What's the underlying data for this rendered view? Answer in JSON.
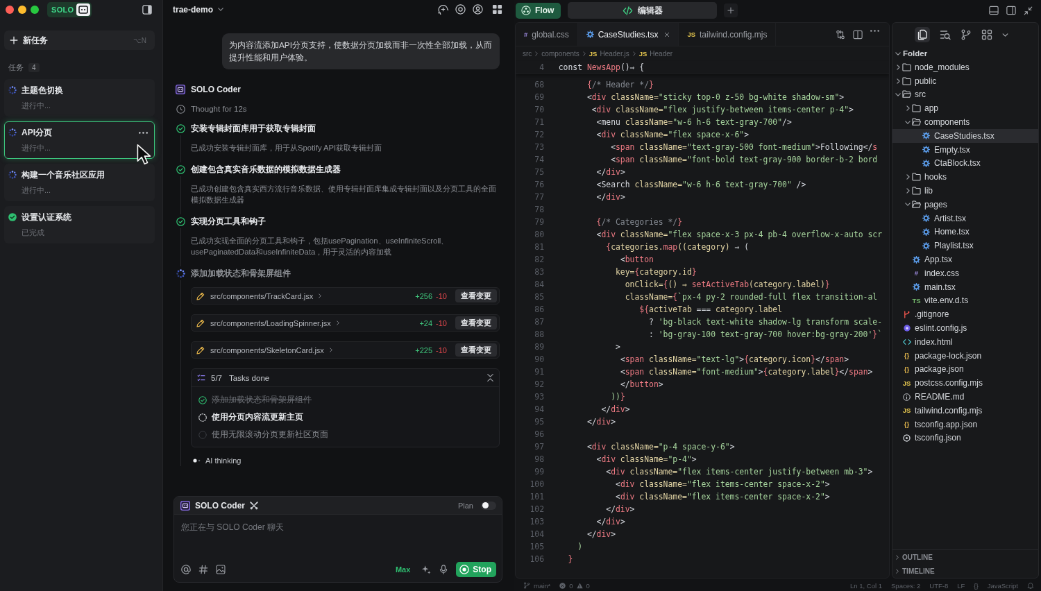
{
  "sidebar": {
    "badge": "SOLO",
    "new_task": {
      "label": "新任务",
      "shortcut": "⌥N"
    },
    "tasks_label": "任务",
    "tasks_count": "4",
    "tasks": [
      {
        "title": "主题色切换",
        "status_text": "进行中...",
        "kind": "running",
        "selected": false
      },
      {
        "title": "API分页",
        "status_text": "进行中...",
        "kind": "running",
        "selected": true
      },
      {
        "title": "构建一个音乐社区应用",
        "status_text": "进行中...",
        "kind": "running",
        "selected": false
      },
      {
        "title": "设置认证系统",
        "status_text": "已完成",
        "kind": "done",
        "selected": false
      }
    ]
  },
  "chat": {
    "project": "trae-demo",
    "user_message": "为内容流添加API分页支持，使数据分页加载而非一次性全部加载，从而提升性能和用户体验。",
    "agent": "SOLO Coder",
    "thought": "Thought for 12s",
    "steps": [
      {
        "title": "安装专辑封面库用于获取专辑封面",
        "detail": "已成功安装专辑封面库，用于从Spotify API获取专辑封面",
        "kind": "done"
      },
      {
        "title": "创建包含真实音乐数据的模拟数据生成器",
        "detail": "已成功创建包含真实西方流行音乐数据、使用专辑封面库集成专辑封面以及分页工具的全面模拟数据生成器",
        "kind": "done"
      },
      {
        "title": "实现分页工具和钩子",
        "detail": "已成功实现全面的分页工具和钩子，包括usePagination、useInfiniteScroll、usePaginatedData和useInfiniteData，用于灵活的内容加载",
        "kind": "done"
      },
      {
        "title": "添加加载状态和骨架屏组件",
        "kind": "running"
      }
    ],
    "changes": [
      {
        "path": "src/components/TrackCard.jsx",
        "added": "+256",
        "removed": "-10",
        "action": "查看变更"
      },
      {
        "path": "src/components/LoadingSpinner.jsx",
        "added": "+24",
        "removed": "-10",
        "action": "查看变更"
      },
      {
        "path": "src/components/SkeletonCard.jsx",
        "added": "+225",
        "removed": "-10",
        "action": "查看变更"
      }
    ],
    "todo": {
      "progress": "5/7",
      "label": "Tasks done",
      "expanded": true,
      "items": [
        {
          "text": "添加加载状态和骨架屏组件",
          "kind": "done"
        },
        {
          "text": "使用分页内容流更新主页",
          "kind": "running"
        },
        {
          "text": "使用无限滚动分页更新社区页面",
          "kind": "pending"
        }
      ]
    },
    "thinking": "AI thinking"
  },
  "composer": {
    "agent": "SOLO Coder",
    "plan_label": "Plan",
    "plan_on": false,
    "placeholder": "您正在与 SOLO Coder 聊天",
    "mode": "Max",
    "stop": "Stop"
  },
  "topbar": {
    "flow": "Flow",
    "view_tab": "编辑器"
  },
  "editor": {
    "tabs": [
      {
        "label": "global.css",
        "kind": "css",
        "glyph": "#",
        "selected": false
      },
      {
        "label": "CaseStudies.tsx",
        "kind": "react",
        "selected": true
      },
      {
        "label": "tailwind.config.mjs",
        "kind": "js",
        "glyph": "JS",
        "selected": false
      }
    ],
    "breadcrumbs": [
      {
        "label": "src"
      },
      {
        "label": "components"
      },
      {
        "label": "Header.js",
        "kind": "js",
        "glyph": "JS"
      },
      {
        "label": "Header",
        "kind": "js",
        "glyph": "JS"
      }
    ],
    "sticky_line": {
      "n": "4",
      "code": [
        {
          "kind": "text",
          "text": "  const "
        },
        {
          "kind": "name",
          "text": "NewsApp"
        },
        {
          "kind": "text",
          "text": "()⇒ {"
        }
      ]
    },
    "lines": [
      {
        "n": "68",
        "code": [
          {
            "kind": "name",
            "text": "        {"
          },
          {
            "kind": "comment",
            "text": "/* Header */"
          },
          {
            "kind": "name",
            "text": "}"
          }
        ]
      },
      {
        "n": "69",
        "code": [
          {
            "kind": "text",
            "text": "        <"
          },
          {
            "kind": "name",
            "text": "div"
          },
          {
            "kind": "attr",
            "text": " className="
          },
          {
            "kind": "string",
            "text": "\"sticky top-0 z-50 bg-white shadow-sm\""
          },
          {
            "kind": "text",
            "text": ">"
          }
        ]
      },
      {
        "n": "70",
        "code": [
          {
            "kind": "text",
            "text": "         <"
          },
          {
            "kind": "name",
            "text": "div"
          },
          {
            "kind": "attr",
            "text": " className="
          },
          {
            "kind": "string",
            "text": "\"flex justify-between items-center p-4\""
          },
          {
            "kind": "text",
            "text": ">"
          }
        ]
      },
      {
        "n": "71",
        "code": [
          {
            "kind": "text",
            "text": "          <menu"
          },
          {
            "kind": "attr",
            "text": " className="
          },
          {
            "kind": "string",
            "text": "\"w-6 h-6 text-gray-700\""
          },
          {
            "kind": "text",
            "text": "/>"
          }
        ]
      },
      {
        "n": "72",
        "code": [
          {
            "kind": "text",
            "text": "          <"
          },
          {
            "kind": "name",
            "text": "div"
          },
          {
            "kind": "attr",
            "text": " className="
          },
          {
            "kind": "string",
            "text": "\"flex space-x-6\""
          },
          {
            "kind": "text",
            "text": ">"
          }
        ]
      },
      {
        "n": "73",
        "code": [
          {
            "kind": "text",
            "text": "             <"
          },
          {
            "kind": "name",
            "text": "span"
          },
          {
            "kind": "attr",
            "text": " className="
          },
          {
            "kind": "string",
            "text": "\"text-gray-500 font-medium\""
          },
          {
            "kind": "text",
            "text": ">Following</"
          },
          {
            "kind": "name",
            "text": "s"
          }
        ]
      },
      {
        "n": "74",
        "code": [
          {
            "kind": "text",
            "text": "             <"
          },
          {
            "kind": "name",
            "text": "span"
          },
          {
            "kind": "attr",
            "text": " className="
          },
          {
            "kind": "string",
            "text": "\"font-bold text-gray-900 border-b-2 bord"
          }
        ]
      },
      {
        "n": "75",
        "code": [
          {
            "kind": "text",
            "text": "          </"
          },
          {
            "kind": "name",
            "text": "div"
          },
          {
            "kind": "text",
            "text": ">"
          }
        ]
      },
      {
        "n": "76",
        "code": [
          {
            "kind": "text",
            "text": "          <Search"
          },
          {
            "kind": "attr",
            "text": " className="
          },
          {
            "kind": "string",
            "text": "\"w-6 h-6 text-gray-700\""
          },
          {
            "kind": "text",
            "text": " />"
          }
        ]
      },
      {
        "n": "77",
        "code": [
          {
            "kind": "text",
            "text": "          </"
          },
          {
            "kind": "name",
            "text": "div"
          },
          {
            "kind": "text",
            "text": ">"
          }
        ]
      },
      {
        "n": "78"
      },
      {
        "n": "79",
        "code": [
          {
            "kind": "name",
            "text": "          {"
          },
          {
            "kind": "comment",
            "text": "/* Categories */"
          },
          {
            "kind": "name",
            "text": "}"
          }
        ]
      },
      {
        "n": "80",
        "code": [
          {
            "kind": "text",
            "text": "          <"
          },
          {
            "kind": "name",
            "text": "div"
          },
          {
            "kind": "attr",
            "text": " className="
          },
          {
            "kind": "string",
            "text": "\"flex space-x-3 px-4 pb-4 overflow-x-auto scr"
          }
        ]
      },
      {
        "n": "81",
        "code": [
          {
            "kind": "name",
            "text": "            {"
          },
          {
            "kind": "attr",
            "text": "categories."
          },
          {
            "kind": "name",
            "text": "map"
          },
          {
            "kind": "attr",
            "text": "((category)"
          },
          {
            "kind": "text",
            "text": " ⇒ ("
          }
        ]
      },
      {
        "n": "82",
        "code": [
          {
            "kind": "text",
            "text": "               <"
          },
          {
            "kind": "name",
            "text": "button"
          }
        ]
      },
      {
        "n": "83",
        "code": [
          {
            "kind": "attr",
            "text": "              key="
          },
          {
            "kind": "name",
            "text": "{"
          },
          {
            "kind": "attr",
            "text": "category.id"
          },
          {
            "kind": "name",
            "text": "}"
          }
        ]
      },
      {
        "n": "84",
        "code": [
          {
            "kind": "attr",
            "text": "                onClick="
          },
          {
            "kind": "name",
            "text": "{"
          },
          {
            "kind": "attr",
            "text": "() ⇒ "
          },
          {
            "kind": "name",
            "text": "setActiveTab"
          },
          {
            "kind": "attr",
            "text": "(category.label)"
          },
          {
            "kind": "name",
            "text": "}"
          }
        ]
      },
      {
        "n": "85",
        "code": [
          {
            "kind": "attr",
            "text": "                className="
          },
          {
            "kind": "name",
            "text": "{"
          },
          {
            "kind": "string",
            "text": "`px-4 py-2 rounded-full flex transition-al"
          }
        ]
      },
      {
        "n": "86",
        "code": [
          {
            "kind": "name",
            "text": "                   ${"
          },
          {
            "kind": "attr",
            "text": "activeTab"
          },
          {
            "kind": "text",
            "text": " === "
          },
          {
            "kind": "attr",
            "text": "category.label"
          }
        ]
      },
      {
        "n": "87",
        "code": [
          {
            "kind": "text",
            "text": "                     ? "
          },
          {
            "kind": "string",
            "text": "'bg-black text-white shadow-lg transform scale-"
          }
        ]
      },
      {
        "n": "88",
        "code": [
          {
            "kind": "text",
            "text": "                     : "
          },
          {
            "kind": "string",
            "text": "'bg-gray-100 text-gray-700 hover:bg-gray-200'"
          },
          {
            "kind": "name",
            "text": "}"
          },
          {
            "kind": "string",
            "text": "`"
          }
        ]
      },
      {
        "n": "89",
        "code": [
          {
            "kind": "text",
            "text": "              >"
          }
        ]
      },
      {
        "n": "90",
        "code": [
          {
            "kind": "text",
            "text": "               <"
          },
          {
            "kind": "name",
            "text": "span"
          },
          {
            "kind": "attr",
            "text": " className="
          },
          {
            "kind": "string",
            "text": "\"text-lg\""
          },
          {
            "kind": "text",
            "text": ">"
          },
          {
            "kind": "name",
            "text": "{"
          },
          {
            "kind": "attr",
            "text": "category.icon"
          },
          {
            "kind": "name",
            "text": "}"
          },
          {
            "kind": "text",
            "text": "</"
          },
          {
            "kind": "name",
            "text": "span"
          },
          {
            "kind": "text",
            "text": ">"
          }
        ]
      },
      {
        "n": "91",
        "code": [
          {
            "kind": "text",
            "text": "               <"
          },
          {
            "kind": "name",
            "text": "span"
          },
          {
            "kind": "attr",
            "text": " className="
          },
          {
            "kind": "string",
            "text": "\"font-medium\""
          },
          {
            "kind": "text",
            "text": ">"
          },
          {
            "kind": "name",
            "text": "{"
          },
          {
            "kind": "attr",
            "text": "category.label"
          },
          {
            "kind": "name",
            "text": "}"
          },
          {
            "kind": "text",
            "text": "</"
          },
          {
            "kind": "name",
            "text": "span"
          },
          {
            "kind": "text",
            "text": ">"
          }
        ]
      },
      {
        "n": "92",
        "code": [
          {
            "kind": "text",
            "text": "               </"
          },
          {
            "kind": "name",
            "text": "button"
          },
          {
            "kind": "text",
            "text": ">"
          }
        ]
      },
      {
        "n": "93",
        "code": [
          {
            "kind": "string",
            "text": "             ))"
          },
          {
            "kind": "name",
            "text": "}"
          }
        ]
      },
      {
        "n": "94",
        "code": [
          {
            "kind": "text",
            "text": "           </"
          },
          {
            "kind": "name",
            "text": "div"
          },
          {
            "kind": "text",
            "text": ">"
          }
        ]
      },
      {
        "n": "95",
        "code": [
          {
            "kind": "text",
            "text": "        </"
          },
          {
            "kind": "name",
            "text": "div"
          },
          {
            "kind": "text",
            "text": ">"
          }
        ]
      },
      {
        "n": "96"
      },
      {
        "n": "97",
        "code": [
          {
            "kind": "text",
            "text": "        <"
          },
          {
            "kind": "name",
            "text": "div"
          },
          {
            "kind": "attr",
            "text": " className="
          },
          {
            "kind": "string",
            "text": "\"p-4 space-y-6\""
          },
          {
            "kind": "text",
            "text": ">"
          }
        ]
      },
      {
        "n": "98",
        "code": [
          {
            "kind": "text",
            "text": "          <"
          },
          {
            "kind": "name",
            "text": "div"
          },
          {
            "kind": "attr",
            "text": " className="
          },
          {
            "kind": "string",
            "text": "\"p-4\""
          },
          {
            "kind": "text",
            "text": ">"
          }
        ]
      },
      {
        "n": "99",
        "code": [
          {
            "kind": "text",
            "text": "            <"
          },
          {
            "kind": "name",
            "text": "div"
          },
          {
            "kind": "attr",
            "text": " className="
          },
          {
            "kind": "string",
            "text": "\"flex items-center justify-between mb-3\""
          },
          {
            "kind": "text",
            "text": ">"
          }
        ]
      },
      {
        "n": "100",
        "code": [
          {
            "kind": "text",
            "text": "              <"
          },
          {
            "kind": "name",
            "text": "div"
          },
          {
            "kind": "attr",
            "text": " className="
          },
          {
            "kind": "string",
            "text": "\"flex items-center space-x-2\""
          },
          {
            "kind": "text",
            "text": ">"
          }
        ]
      },
      {
        "n": "101",
        "code": [
          {
            "kind": "text",
            "text": "              <"
          },
          {
            "kind": "name",
            "text": "div"
          },
          {
            "kind": "attr",
            "text": " className="
          },
          {
            "kind": "string",
            "text": "\"flex items-center space-x-2\""
          },
          {
            "kind": "text",
            "text": ">"
          }
        ]
      },
      {
        "n": "102",
        "code": [
          {
            "kind": "text",
            "text": "            </"
          },
          {
            "kind": "name",
            "text": "div"
          },
          {
            "kind": "text",
            "text": ">"
          }
        ]
      },
      {
        "n": "103",
        "code": [
          {
            "kind": "text",
            "text": "          </"
          },
          {
            "kind": "name",
            "text": "div"
          },
          {
            "kind": "text",
            "text": ">"
          }
        ]
      },
      {
        "n": "104",
        "code": [
          {
            "kind": "text",
            "text": "        </"
          },
          {
            "kind": "name",
            "text": "div"
          },
          {
            "kind": "text",
            "text": ">"
          }
        ]
      },
      {
        "n": "105",
        "code": [
          {
            "kind": "string",
            "text": "      )"
          }
        ]
      },
      {
        "n": "106",
        "code": [
          {
            "kind": "name",
            "text": "    }"
          }
        ]
      }
    ]
  },
  "explorer": {
    "root": "Folder",
    "expanded": true,
    "items": [
      {
        "name": "node_modules",
        "kind": "folder",
        "expanded": false,
        "selected": false
      },
      {
        "name": "public",
        "kind": "folder",
        "expanded": false,
        "selected": false
      },
      {
        "name": "src",
        "kind": "folder",
        "expanded": true,
        "selected": false,
        "children": [
          {
            "name": "app",
            "kind": "folder",
            "expanded": false,
            "selected": false
          },
          {
            "name": "components",
            "kind": "folder",
            "expanded": true,
            "selected": false,
            "children": [
              {
                "name": "CaseStudies.tsx",
                "kind": "react",
                "selected": true
              },
              {
                "name": "Empty.tsx",
                "kind": "react",
                "selected": false
              },
              {
                "name": "CtaBlock.tsx",
                "kind": "react",
                "selected": false
              }
            ]
          },
          {
            "name": "hooks",
            "kind": "folder",
            "expanded": false,
            "selected": false
          },
          {
            "name": "lib",
            "kind": "folder",
            "expanded": false,
            "selected": false
          },
          {
            "name": "pages",
            "kind": "folder",
            "expanded": true,
            "selected": false,
            "children": [
              {
                "name": "Artist.tsx",
                "kind": "react",
                "selected": false
              },
              {
                "name": "Home.tsx",
                "kind": "react",
                "selected": false
              },
              {
                "name": "Playlist.tsx",
                "kind": "react",
                "selected": false
              }
            ]
          },
          {
            "name": "App.tsx",
            "kind": "react",
            "selected": false
          },
          {
            "name": "index.css",
            "kind": "css",
            "glyph": "#",
            "selected": false
          },
          {
            "name": "main.tsx",
            "kind": "react",
            "selected": false
          },
          {
            "name": "vite.env.d.ts",
            "kind": "ts",
            "glyph": "TS",
            "selected": false
          }
        ]
      },
      {
        "name": ".gitignore",
        "kind": "git",
        "selected": false
      },
      {
        "name": "eslint.config.js",
        "kind": "eslint",
        "selected": false
      },
      {
        "name": "index.html",
        "kind": "html",
        "selected": false
      },
      {
        "name": "package-lock.json",
        "kind": "json",
        "glyph": "{}",
        "selected": false
      },
      {
        "name": "package.json",
        "kind": "json",
        "glyph": "{}",
        "selected": false
      },
      {
        "name": "postcss.config.mjs",
        "kind": "js",
        "glyph": "JS",
        "selected": false
      },
      {
        "name": "README.md",
        "kind": "info",
        "selected": false
      },
      {
        "name": "tailwind.config.mjs",
        "kind": "js",
        "glyph": "JS",
        "selected": false
      },
      {
        "name": "tsconfig.app.json",
        "kind": "json",
        "glyph": "{}",
        "selected": false
      },
      {
        "name": "tsconfig.json",
        "kind": "settings",
        "selected": false
      }
    ],
    "sections": [
      {
        "label": "OUTLINE",
        "expanded": false
      },
      {
        "label": "TIMELINE",
        "expanded": false
      }
    ]
  },
  "status_bar": {
    "branch": "main*",
    "errors": "0",
    "warnings": "0",
    "position": "Ln 1, Col 1",
    "indent": "Spaces: 2",
    "encoding": "UTF-8",
    "eol": "LF",
    "braces": "{}",
    "language": "JavaScript"
  }
}
